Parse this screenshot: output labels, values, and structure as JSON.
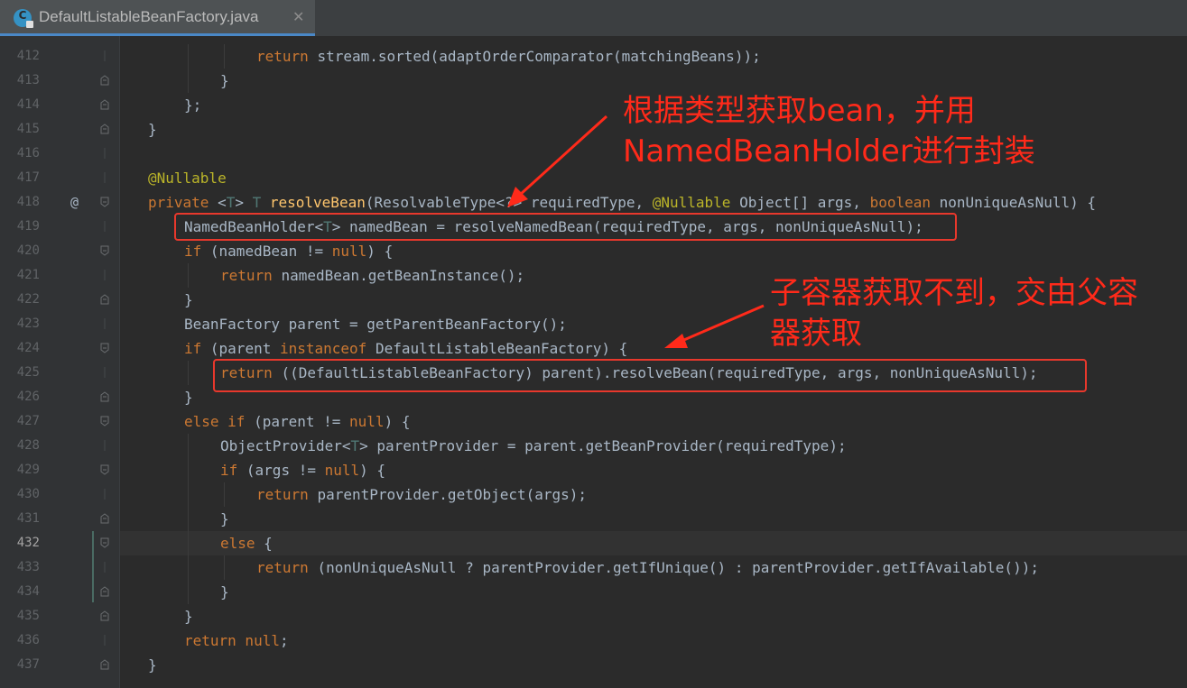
{
  "tab": {
    "icon": "java-class-icon",
    "icon_letter": "C",
    "title": "DefaultListableBeanFactory.java",
    "close": "✕"
  },
  "editor": {
    "lines": [
      {
        "no": "412",
        "indent": 6,
        "tokens": [
          [
            "k",
            "return "
          ],
          [
            "",
            "stream.sorted(adaptOrderComparator(matchingBeans));"
          ]
        ],
        "fold": "none"
      },
      {
        "no": "413",
        "indent": 5,
        "tokens": [
          [
            "",
            "}"
          ]
        ],
        "fold": "end"
      },
      {
        "no": "414",
        "indent": 4,
        "tokens": [
          [
            "",
            "};"
          ]
        ],
        "fold": "end"
      },
      {
        "no": "415",
        "indent": 3,
        "tokens": [
          [
            "",
            "}"
          ]
        ],
        "fold": "end"
      },
      {
        "no": "416",
        "indent": 0,
        "tokens": [],
        "fold": "none"
      },
      {
        "no": "417",
        "indent": 3,
        "tokens": [
          [
            "an",
            "@Nullable"
          ]
        ],
        "fold": "none"
      },
      {
        "no": "418",
        "indent": 3,
        "tokens": [
          [
            "k",
            "private "
          ],
          [
            "",
            "<"
          ],
          [
            "tp",
            "T"
          ],
          [
            "",
            "> "
          ],
          [
            "tp",
            "T "
          ],
          [
            "fn",
            "resolveBean"
          ],
          [
            "",
            "(ResolvableType<?> requiredType, "
          ],
          [
            "an",
            "@Nullable "
          ],
          [
            "",
            "Object[] args, "
          ],
          [
            "k",
            "boolean "
          ],
          [
            "",
            "nonUniqueAsNull) {"
          ]
        ],
        "fold": "start",
        "mark": "@"
      },
      {
        "no": "419",
        "indent": 4,
        "tokens": [
          [
            "",
            "NamedBeanHolder<"
          ],
          [
            "tp",
            "T"
          ],
          [
            "",
            "> namedBean = resolveNamedBean(requiredType, args, nonUniqueAsNull);"
          ]
        ],
        "fold": "none"
      },
      {
        "no": "420",
        "indent": 4,
        "tokens": [
          [
            "k",
            "if "
          ],
          [
            "",
            "(namedBean != "
          ],
          [
            "k",
            "null"
          ],
          [
            "",
            ") {"
          ]
        ],
        "fold": "start"
      },
      {
        "no": "421",
        "indent": 5,
        "tokens": [
          [
            "k",
            "return "
          ],
          [
            "",
            "namedBean.getBeanInstance();"
          ]
        ],
        "fold": "none"
      },
      {
        "no": "422",
        "indent": 4,
        "tokens": [
          [
            "",
            "}"
          ]
        ],
        "fold": "end"
      },
      {
        "no": "423",
        "indent": 4,
        "tokens": [
          [
            "",
            "BeanFactory parent = getParentBeanFactory();"
          ]
        ],
        "fold": "none"
      },
      {
        "no": "424",
        "indent": 4,
        "tokens": [
          [
            "k",
            "if "
          ],
          [
            "",
            "(parent "
          ],
          [
            "k",
            "instanceof "
          ],
          [
            "",
            "DefaultListableBeanFactory) {"
          ]
        ],
        "fold": "start"
      },
      {
        "no": "425",
        "indent": 5,
        "tokens": [
          [
            "k",
            "return "
          ],
          [
            "",
            "((DefaultListableBeanFactory) parent).resolveBean(requiredType, args, nonUniqueAsNull);"
          ]
        ],
        "fold": "none"
      },
      {
        "no": "426",
        "indent": 4,
        "tokens": [
          [
            "",
            "}"
          ]
        ],
        "fold": "end"
      },
      {
        "no": "427",
        "indent": 4,
        "tokens": [
          [
            "k",
            "else if "
          ],
          [
            "",
            "(parent != "
          ],
          [
            "k",
            "null"
          ],
          [
            "",
            ") {"
          ]
        ],
        "fold": "start"
      },
      {
        "no": "428",
        "indent": 5,
        "tokens": [
          [
            "",
            "ObjectProvider<"
          ],
          [
            "tp",
            "T"
          ],
          [
            "",
            "> parentProvider = parent.getBeanProvider(requiredType);"
          ]
        ],
        "fold": "none"
      },
      {
        "no": "429",
        "indent": 5,
        "tokens": [
          [
            "k",
            "if "
          ],
          [
            "",
            "(args != "
          ],
          [
            "k",
            "null"
          ],
          [
            "",
            ") {"
          ]
        ],
        "fold": "start"
      },
      {
        "no": "430",
        "indent": 6,
        "tokens": [
          [
            "k",
            "return "
          ],
          [
            "",
            "parentProvider.getObject(args);"
          ]
        ],
        "fold": "none"
      },
      {
        "no": "431",
        "indent": 5,
        "tokens": [
          [
            "",
            "}"
          ]
        ],
        "fold": "end"
      },
      {
        "no": "432",
        "indent": 5,
        "tokens": [
          [
            "k",
            "else "
          ],
          [
            "",
            "{"
          ]
        ],
        "fold": "start",
        "current": true
      },
      {
        "no": "433",
        "indent": 6,
        "tokens": [
          [
            "k",
            "return "
          ],
          [
            "",
            "(nonUniqueAsNull ? parentProvider.getIfUnique() : parentProvider.getIfAvailable());"
          ]
        ],
        "fold": "none"
      },
      {
        "no": "434",
        "indent": 5,
        "tokens": [
          [
            "",
            "}"
          ]
        ],
        "fold": "end"
      },
      {
        "no": "435",
        "indent": 4,
        "tokens": [
          [
            "",
            "}"
          ]
        ],
        "fold": "end"
      },
      {
        "no": "436",
        "indent": 4,
        "tokens": [
          [
            "k",
            "return null"
          ],
          [
            "",
            ";"
          ]
        ],
        "fold": "none"
      },
      {
        "no": "437",
        "indent": 3,
        "tokens": [
          [
            "",
            "}"
          ]
        ],
        "fold": "end"
      }
    ]
  },
  "annotations": [
    {
      "id": "annotation-bean-by-type",
      "lines": [
        "根据类型获取bean，并用",
        "NamedBeanHolder进行封装"
      ]
    },
    {
      "id": "annotation-parent-container",
      "lines": [
        "子容器获取不到，交由父容",
        "器获取"
      ]
    }
  ],
  "colors": {
    "annotation": "#ff2a1a",
    "keyword": "#cc7832",
    "annotation_code": "#bbb529",
    "method": "#ffc66d"
  }
}
